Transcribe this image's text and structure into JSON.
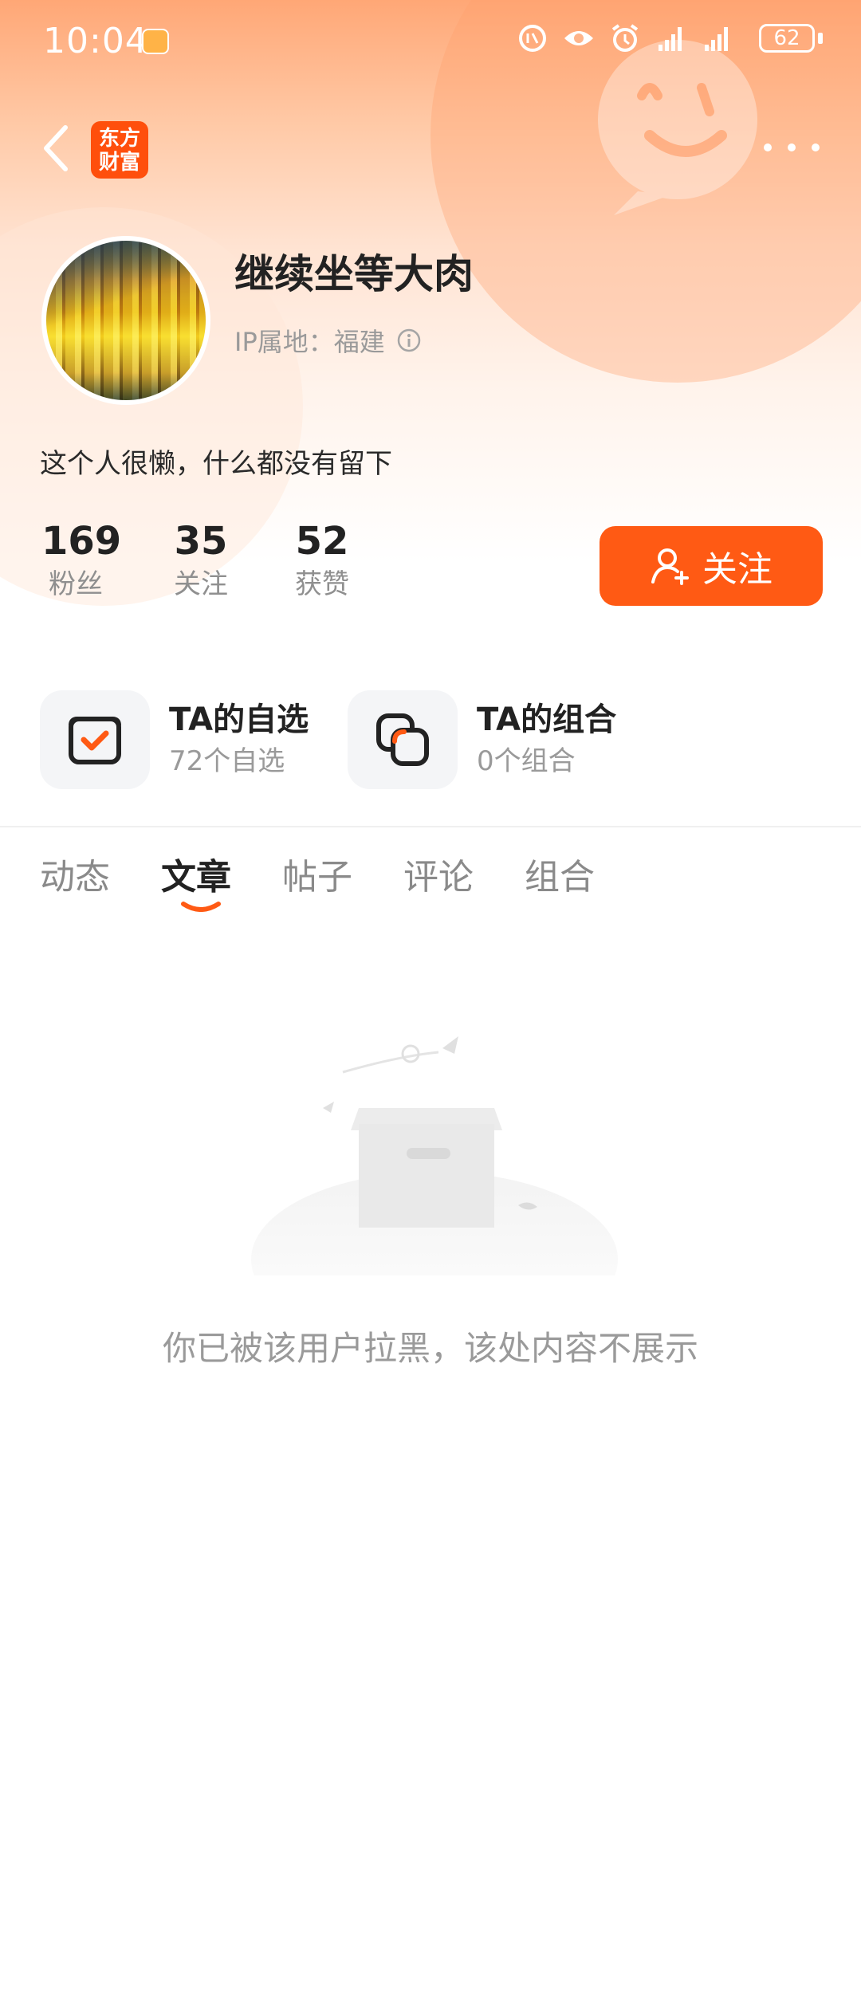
{
  "status_bar": {
    "time": "10:04",
    "battery": "62"
  },
  "nav": {
    "logo_text": "东方\n财富"
  },
  "profile": {
    "username": "继续坐等大肉",
    "ip_location": "IP属地：福建",
    "bio": "这个人很懒，什么都没有留下"
  },
  "stats": [
    {
      "value": "169",
      "label": "粉丝"
    },
    {
      "value": "35",
      "label": "关注"
    },
    {
      "value": "52",
      "label": "获赞"
    }
  ],
  "follow_button": "关注",
  "shortcuts": [
    {
      "title": "TA的自选",
      "subtitle": "72个自选"
    },
    {
      "title": "TA的组合",
      "subtitle": "0个组合"
    }
  ],
  "tabs": [
    "动态",
    "文章",
    "帖子",
    "评论",
    "组合"
  ],
  "active_tab": "文章",
  "empty_message": "你已被该用户拉黑，该处内容不展示",
  "colors": {
    "accent": "#ff5a14",
    "header_gradient_top": "#ffa776"
  },
  "icons": {
    "back": "chevron-left-icon",
    "more": "more-dots-icon",
    "info": "info-icon",
    "follow": "add-user-icon",
    "watchlist": "checkbox-icon",
    "portfolio": "stacked-squares-icon"
  }
}
